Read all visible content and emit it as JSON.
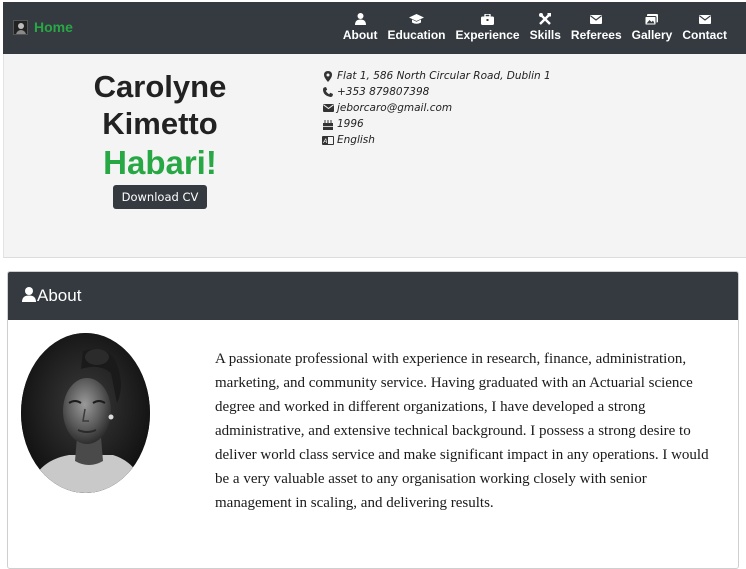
{
  "nav": {
    "brand": "Home",
    "items": [
      {
        "label": "About",
        "icon": "user-icon"
      },
      {
        "label": "Education",
        "icon": "graduation-cap-icon"
      },
      {
        "label": "Experience",
        "icon": "briefcase-icon"
      },
      {
        "label": "Skills",
        "icon": "tools-icon"
      },
      {
        "label": "Referees",
        "icon": "envelope-icon"
      },
      {
        "label": "Gallery",
        "icon": "images-icon"
      },
      {
        "label": "Contact",
        "icon": "envelope-icon"
      }
    ]
  },
  "hero": {
    "first_name": "Carolyne",
    "last_name": "Kimetto",
    "greeting": "Habari!",
    "cv_button": "Download CV",
    "info": [
      {
        "icon": "map-marker-icon",
        "text": "Flat 1, 586 North Circular Road, Dublin 1"
      },
      {
        "icon": "phone-icon",
        "text": "+353 879807398"
      },
      {
        "icon": "envelope-icon",
        "text": "jeborcaro@gmail.com"
      },
      {
        "icon": "birthday-cake-icon",
        "text": "1996"
      },
      {
        "icon": "language-icon",
        "text": "English"
      }
    ]
  },
  "about": {
    "title": "About",
    "text": "A passionate professional with experience in research, finance, administration, marketing, and community service. Having graduated with an Actuarial science degree and worked in different organizations, I have developed a strong administrative, and extensive technical background. I possess a strong desire to deliver world class service and make significant impact in any operations. I would be a very valuable asset to any organisation working closely with senior management in scaling, and delivering results."
  },
  "colors": {
    "navbar": "#343a40",
    "accent_green": "#28a745",
    "hero_bg": "#f4f4f4"
  }
}
